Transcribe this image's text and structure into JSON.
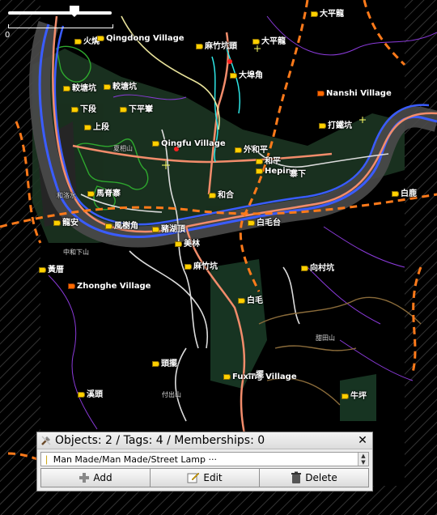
{
  "map": {
    "labels": [
      {
        "text": "大平龍",
        "icon": "yellow"
      },
      {
        "text": "火燒",
        "icon": "yellow"
      },
      {
        "text": "Qingdong Village",
        "icon": "yellow"
      },
      {
        "text": "麻竹坑頭",
        "icon": "yellow"
      },
      {
        "text": "大平龍",
        "icon": "yellow"
      },
      {
        "text": "大埠角",
        "icon": "yellow"
      },
      {
        "text": "較塘坑",
        "icon": "yellow"
      },
      {
        "text": "較塘坑",
        "icon": "yellow"
      },
      {
        "text": "下段",
        "icon": "yellow"
      },
      {
        "text": "下平輋",
        "icon": "yellow"
      },
      {
        "text": "上段",
        "icon": "yellow"
      },
      {
        "text": "Nanshi Village",
        "icon": "orange"
      },
      {
        "text": "打鐵坑",
        "icon": "yellow"
      },
      {
        "text": "Qingfu Village",
        "icon": "yellow"
      },
      {
        "text": "外和平",
        "icon": "yellow"
      },
      {
        "text": "和平",
        "icon": "yellow"
      },
      {
        "text": "Heping",
        "icon": "yellow"
      },
      {
        "text": "寨下",
        "icon": "none"
      },
      {
        "text": "馬脊寨",
        "icon": "yellow"
      },
      {
        "text": "和合",
        "icon": "yellow"
      },
      {
        "text": "白鹿",
        "icon": "yellow"
      },
      {
        "text": "龍安",
        "icon": "yellow"
      },
      {
        "text": "風樹角",
        "icon": "yellow"
      },
      {
        "text": "豬湖頂",
        "icon": "yellow"
      },
      {
        "text": "白毛台",
        "icon": "yellow"
      },
      {
        "text": "美林",
        "icon": "yellow"
      },
      {
        "text": "黃厝",
        "icon": "yellow"
      },
      {
        "text": "麻竹坑",
        "icon": "yellow"
      },
      {
        "text": "向村坑",
        "icon": "yellow"
      },
      {
        "text": "Zhonghe Village",
        "icon": "orange"
      },
      {
        "text": "白毛",
        "icon": "yellow"
      },
      {
        "text": "頭擺",
        "icon": "yellow"
      },
      {
        "text": "Fuxing Village",
        "icon": "yellow"
      },
      {
        "text": "溪頭",
        "icon": "yellow"
      },
      {
        "text": "牛坪",
        "icon": "yellow"
      },
      {
        "text": "一擺",
        "icon": "none"
      }
    ],
    "small_labels": [
      "夏相山",
      "中和下山",
      "付出山",
      "甜田山",
      "和洛水"
    ]
  },
  "zoom": {
    "zero_label": "0",
    "level": 0.64
  },
  "dialog": {
    "title": "Objects: 2 / Tags: 4 / Memberships: 0",
    "close_label": "✕",
    "list_item": "Man Made/Man Made/Street Lamp ···",
    "buttons": {
      "add": "Add",
      "edit": "Edit",
      "delete": "Delete"
    }
  },
  "colors": {
    "background": "#000000",
    "river": "#3a5cff",
    "highway": "#f28c6b",
    "boundary": "#ff7a1a",
    "road_white": "#e6e6e6",
    "landuse_green": "#1f3a24",
    "forest": "#2ea82e",
    "stream_cyan": "#2ee6e6"
  }
}
